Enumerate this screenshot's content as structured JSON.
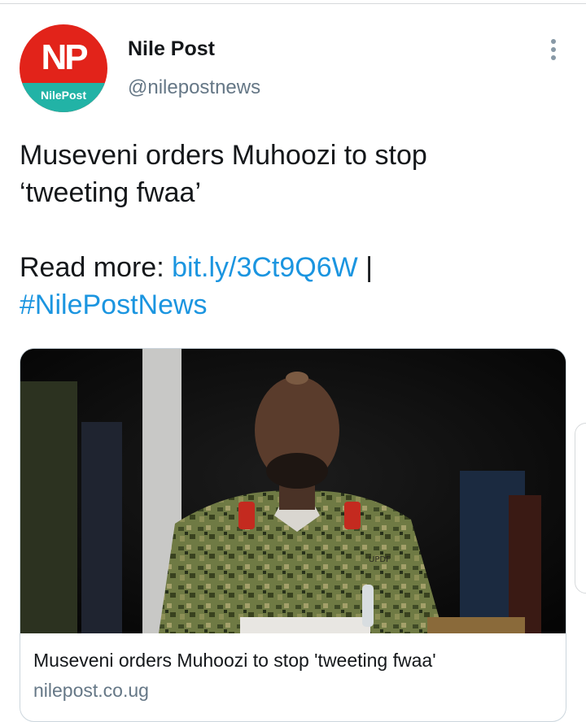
{
  "account": {
    "name": "Nile Post",
    "handle": "@nilepostnews",
    "avatar_initials": "NP",
    "avatar_brand": "NilePost",
    "avatar_colors": {
      "top": "#e2231a",
      "band": "#22b3a6"
    }
  },
  "tweet": {
    "line1": "Museveni orders Muhoozi to stop",
    "line2": "‘tweeting fwaa’",
    "read_more_label": "Read more:",
    "link": "bit.ly/3Ct9Q6W",
    "separator": "|",
    "hashtag": "#NilePostNews"
  },
  "card": {
    "title": "Museveni orders Muhoozi to stop 'tweeting fwaa'",
    "domain": "nilepost.co.ug",
    "image_badge": "UPDF"
  },
  "icons": {
    "more": "more-vertical-icon"
  },
  "colors": {
    "link": "#1b95e0",
    "secondary_text": "#657786",
    "primary_text": "#14171a"
  }
}
